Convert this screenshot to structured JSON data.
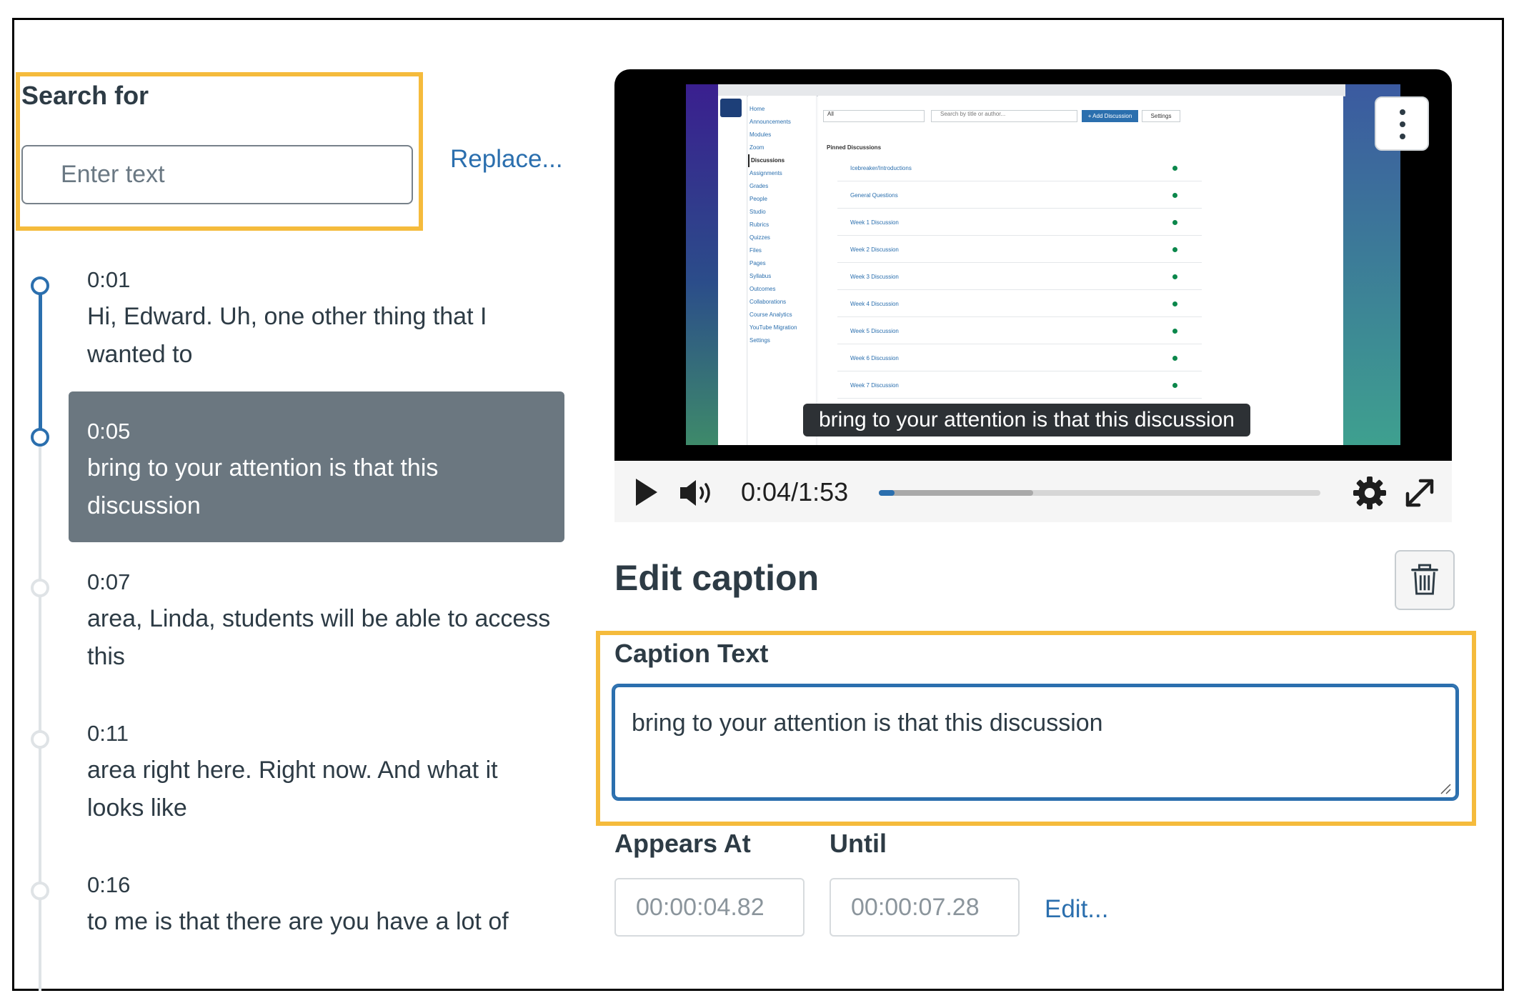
{
  "search": {
    "label": "Search for",
    "placeholder": "Enter text",
    "replace_link": "Replace..."
  },
  "cues": [
    {
      "time": "0:01",
      "text": "Hi, Edward. Uh, one other thing that I wanted to"
    },
    {
      "time": "0:05",
      "text": "bring to your attention is that this discussion"
    },
    {
      "time": "0:07",
      "text": "area, Linda, students will be able to access this"
    },
    {
      "time": "0:11",
      "text": "area right here. Right now. And what it looks like"
    },
    {
      "time": "0:16",
      "text": "to me is that there are you have a lot of"
    }
  ],
  "selected_cue_index": 1,
  "player": {
    "caption_overlay": "bring to your attention is that this discussion",
    "time_display": "0:04/1:53",
    "progress_fraction": 0.035,
    "buffered_fraction": 0.35
  },
  "embedded_screen": {
    "nav": [
      "Home",
      "Announcements",
      "Modules",
      "Zoom",
      "Discussions",
      "Assignments",
      "Grades",
      "People",
      "Studio",
      "Rubrics",
      "Quizzes",
      "Files",
      "Pages",
      "Syllabus",
      "Outcomes",
      "Collaborations",
      "Course Analytics",
      "YouTube Migration",
      "Settings"
    ],
    "current_nav": "Discussions",
    "filter": "All",
    "search_placeholder": "Search by title or author...",
    "add_button": "+ Add Discussion",
    "settings_button": "Settings",
    "section_heading": "Pinned Discussions",
    "discussions": [
      "Icebreaker/Introductions",
      "General Questions",
      "Week 1 Discussion",
      "Week 2 Discussion",
      "Week 3 Discussion",
      "Week 4 Discussion",
      "Week 5 Discussion",
      "Week 6 Discussion",
      "Week 7 Discussion"
    ]
  },
  "editor": {
    "title": "Edit caption",
    "caption_label": "Caption Text",
    "caption_value": "bring to your attention is that this discussion",
    "appears_label": "Appears At",
    "until_label": "Until",
    "appears_value": "00:00:04.82",
    "until_value": "00:00:07.28",
    "edit_link": "Edit..."
  },
  "colors": {
    "highlight": "#f5bb3c",
    "accent": "#2b6fae",
    "selected_cue": "#6b7780"
  }
}
